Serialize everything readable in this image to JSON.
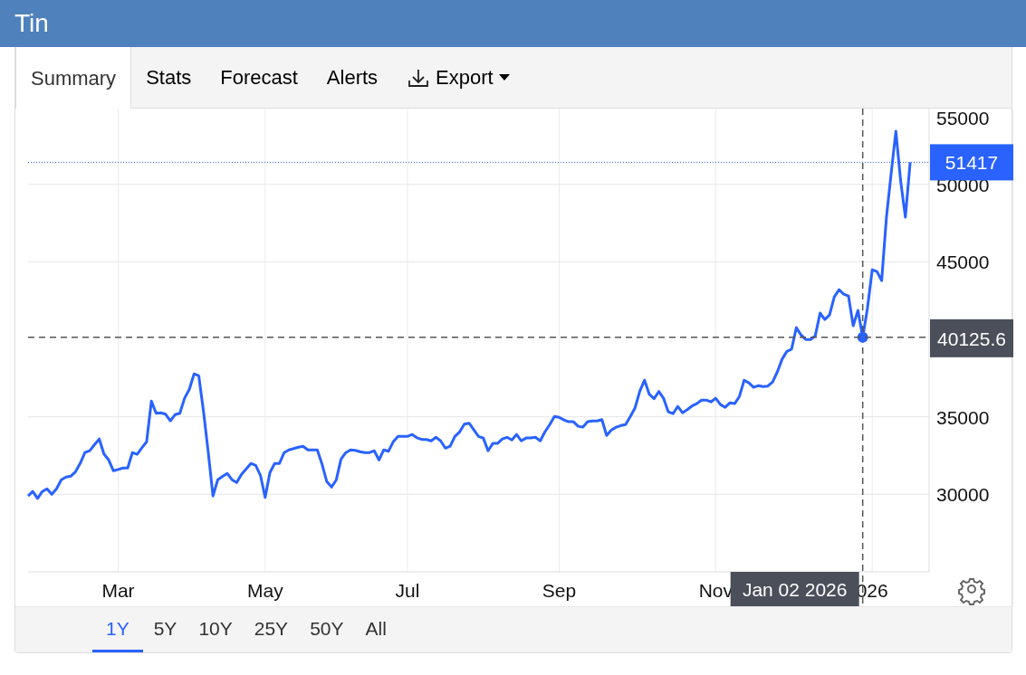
{
  "header": {
    "title": "Tin"
  },
  "tabs": [
    {
      "label": "Summary",
      "selected": true,
      "kind": "tab"
    },
    {
      "label": "Stats",
      "selected": false,
      "kind": "tab"
    },
    {
      "label": "Forecast",
      "selected": false,
      "kind": "tab"
    },
    {
      "label": "Alerts",
      "selected": false,
      "kind": "tab"
    },
    {
      "label": "Export",
      "selected": false,
      "kind": "menu"
    }
  ],
  "chart": {
    "chart_data": {
      "type": "line",
      "grid": true,
      "ylim": [
        25000,
        55000
      ],
      "yticks": [
        30000,
        35000,
        45000,
        50000,
        55000
      ],
      "categories": [
        null,
        null,
        null,
        null,
        null,
        null,
        null,
        null,
        null,
        null,
        null,
        null,
        null,
        null,
        null,
        null,
        null,
        null,
        null,
        "Mar",
        null,
        null,
        null,
        null,
        null,
        null,
        null,
        null,
        null,
        null,
        null,
        null,
        null,
        null,
        null,
        null,
        null,
        null,
        null,
        null,
        null,
        null,
        null,
        null,
        null,
        null,
        null,
        null,
        null,
        null,
        "May",
        null,
        null,
        null,
        null,
        null,
        null,
        null,
        null,
        null,
        null,
        null,
        null,
        null,
        null,
        null,
        null,
        null,
        null,
        null,
        null,
        null,
        null,
        null,
        null,
        null,
        null,
        null,
        null,
        null,
        "Jul",
        null,
        null,
        null,
        null,
        null,
        null,
        null,
        null,
        null,
        null,
        null,
        null,
        null,
        null,
        null,
        null,
        null,
        null,
        null,
        null,
        null,
        null,
        null,
        null,
        null,
        null,
        null,
        null,
        null,
        null,
        null,
        "Sep",
        null,
        null,
        null,
        null,
        null,
        null,
        null,
        null,
        null,
        null,
        null,
        null,
        null,
        null,
        null,
        null,
        null,
        null,
        null,
        null,
        null,
        null,
        null,
        null,
        null,
        null,
        null,
        null,
        null,
        null,
        null,
        null,
        "Nov",
        null,
        null,
        null,
        null,
        null,
        null,
        null,
        null,
        null,
        null,
        null,
        null,
        null,
        null,
        null,
        null,
        null,
        null,
        null,
        null,
        null,
        null,
        null,
        null,
        null,
        null,
        null,
        null,
        null,
        null,
        null,
        null,
        "026",
        null,
        null,
        null,
        null,
        null,
        null,
        null,
        null
      ],
      "series": [
        {
          "color": "#2962ff",
          "values": [
            29890,
            30180,
            29740,
            30180,
            30360,
            30000,
            30360,
            30940,
            31110,
            31170,
            31460,
            32000,
            32690,
            32810,
            33200,
            33570,
            32600,
            32220,
            31520,
            31600,
            31700,
            31700,
            32690,
            32580,
            33000,
            33390,
            36020,
            35230,
            35260,
            35170,
            34740,
            35140,
            35230,
            36200,
            36780,
            37770,
            37650,
            35320,
            32690,
            29890,
            30940,
            31150,
            31350,
            30940,
            30760,
            31290,
            31640,
            31990,
            31870,
            31230,
            29800,
            31410,
            31990,
            31990,
            32690,
            32870,
            32950,
            33040,
            33100,
            32870,
            32870,
            32870,
            31930,
            30820,
            30470,
            30940,
            32280,
            32690,
            32870,
            32840,
            32750,
            32690,
            32690,
            32810,
            32220,
            32870,
            32780,
            33390,
            33740,
            33740,
            33740,
            33860,
            33650,
            33540,
            33540,
            33450,
            33680,
            33450,
            32980,
            33100,
            33740,
            34030,
            34530,
            34590,
            34150,
            33740,
            33630,
            32810,
            33280,
            33280,
            33570,
            33680,
            33510,
            33860,
            33450,
            33630,
            33630,
            33680,
            33450,
            34030,
            34500,
            35030,
            34970,
            34800,
            34680,
            34680,
            34390,
            34330,
            34680,
            34730,
            34730,
            34820,
            33800,
            34150,
            34330,
            34440,
            34500,
            35020,
            35580,
            36660,
            37360,
            36460,
            36170,
            36630,
            36200,
            35320,
            35200,
            35670,
            35260,
            35460,
            35700,
            35850,
            36080,
            36080,
            35960,
            36200,
            35790,
            35610,
            35900,
            35850,
            36310,
            37360,
            37190,
            36900,
            37010,
            36950,
            36980,
            37250,
            37900,
            38720,
            39220,
            39360,
            40750,
            40280,
            39990,
            39990,
            40230,
            41690,
            41280,
            41570,
            42740,
            43200,
            42910,
            42790,
            40870,
            41860,
            40125.6,
            42000,
            44490,
            44370,
            43790,
            47880,
            50700,
            53420,
            50210,
            47880,
            51417
          ]
        }
      ],
      "ref_lines": [
        {
          "axis": "y",
          "value": 51417,
          "label": "51417",
          "color": "#2962ff"
        },
        {
          "axis": "y",
          "value": 40125.6,
          "label": "40125.6"
        }
      ]
    },
    "crosshair": {
      "date_label": "Jan 02 2026"
    }
  },
  "ranges": [
    {
      "label": "1Y",
      "selected": true
    },
    {
      "label": "5Y",
      "selected": false
    },
    {
      "label": "10Y",
      "selected": false
    },
    {
      "label": "25Y",
      "selected": false
    },
    {
      "label": "50Y",
      "selected": false
    },
    {
      "label": "All",
      "selected": false
    }
  ]
}
